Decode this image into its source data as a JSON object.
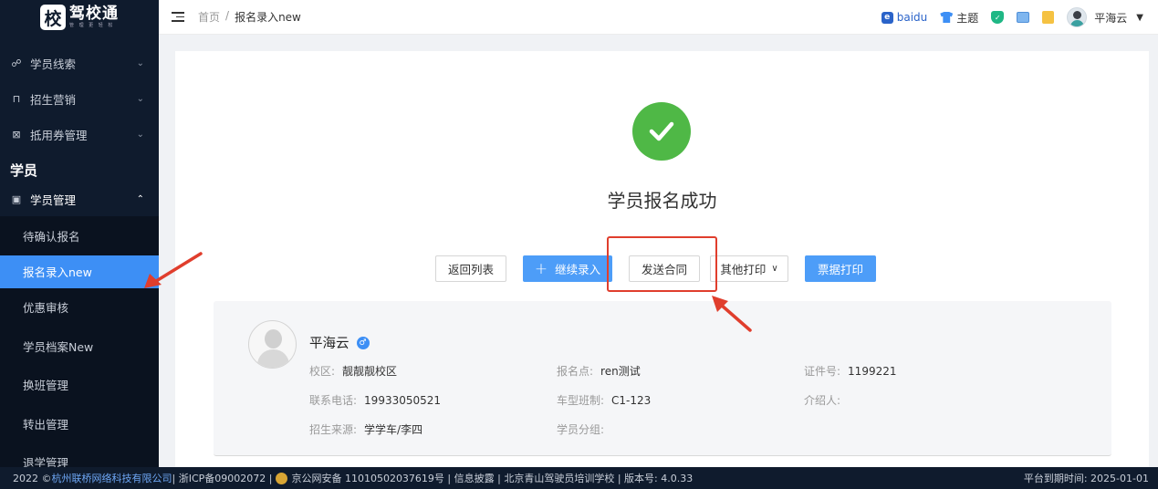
{
  "logo": {
    "glyph": "校",
    "name": "驾校通",
    "tagline": "管 理 更 轻 松"
  },
  "sidebar": {
    "items": [
      {
        "label": "学员线索",
        "icon": "node-icon"
      },
      {
        "label": "招生营销",
        "icon": "shop-icon"
      },
      {
        "label": "抵用券管理",
        "icon": "ticket-icon"
      }
    ],
    "group_title": "学员",
    "manage": {
      "label": "学员管理",
      "icon": "id-card-icon"
    },
    "sub_items": [
      {
        "label": "待确认报名"
      },
      {
        "label": "报名录入new",
        "active": true
      },
      {
        "label": "优惠审核"
      },
      {
        "label": "学员档案New"
      },
      {
        "label": "换班管理"
      },
      {
        "label": "转出管理"
      },
      {
        "label": "退学管理"
      }
    ]
  },
  "header": {
    "breadcrumb": {
      "home": "首页",
      "sep": "/",
      "current": "报名录入new"
    },
    "baidu": "baidu",
    "theme": "主题",
    "user": "平海云"
  },
  "result": {
    "title": "学员报名成功",
    "buttons": {
      "back": "返回列表",
      "continue": "继续录入",
      "continue_icon": "+",
      "send_contract": "发送合同",
      "other_print": "其他打印",
      "ticket_print": "票据打印"
    }
  },
  "student": {
    "name": "平海云",
    "gender": "♂",
    "fields": {
      "campus_label": "校区:",
      "campus": "靓靓靓校区",
      "signup_point_label": "报名点:",
      "signup_point": "ren测试",
      "id_label": "证件号:",
      "id": "1199221",
      "phone_label": "联系电话:",
      "phone": "19933050521",
      "class_label": "车型班制:",
      "class": "C1-123",
      "referrer_label": "介绍人:",
      "referrer": "",
      "source_label": "招生来源:",
      "source": "学学车/李四",
      "group_label": "学员分组:",
      "group": ""
    }
  },
  "footer": {
    "copyright_prefix": "2022 ©",
    "company": "杭州联桥网络科技有限公司",
    "icp": " | 浙ICP备09002072 | ",
    "police": "京公网安备 11010502037619号 | 信息披露 | 北京青山驾驶员培训学校 | 版本号: 4.0.33",
    "expiry": "平台到期时间: 2025-01-01"
  },
  "colors": {
    "sidebar_bg": "#0f1b2d",
    "accent": "#3d8ff5",
    "success": "#4fb846",
    "annotation": "#e03e2d"
  }
}
